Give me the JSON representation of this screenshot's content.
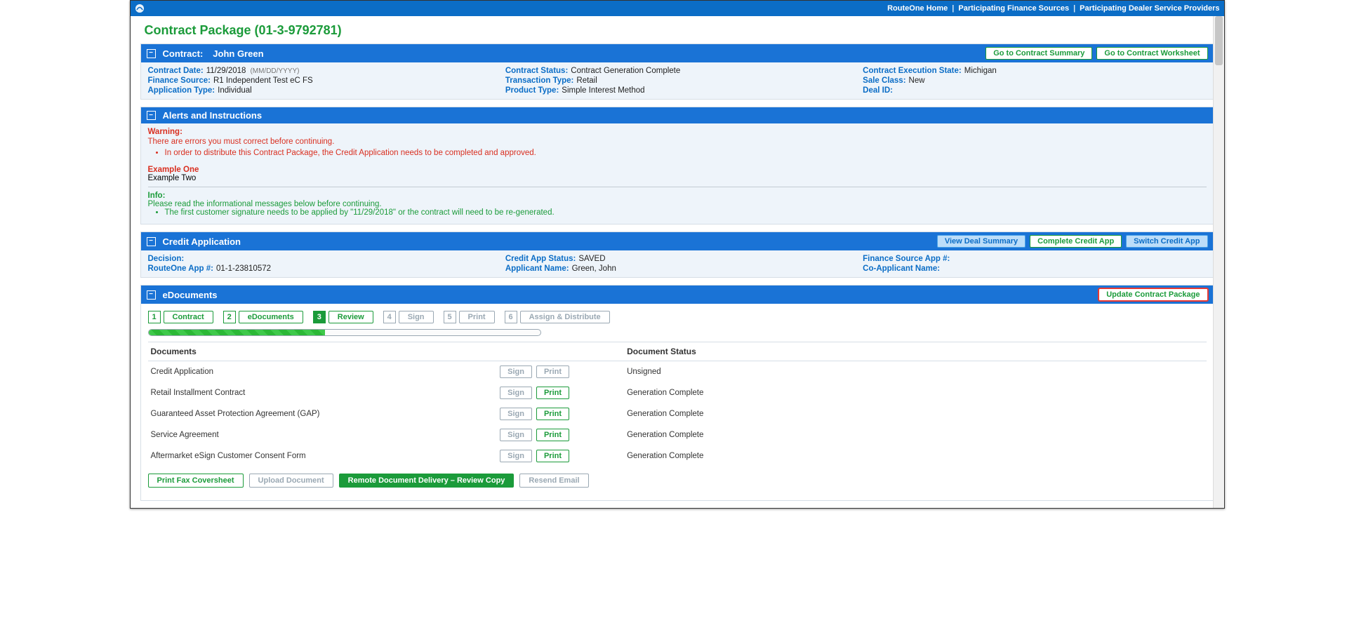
{
  "topbar": {
    "links": [
      "RouteOne Home",
      "Participating Finance Sources",
      "Participating Dealer Service Providers"
    ]
  },
  "page_title": "Contract Package (01-3-9792781)",
  "contract_header": {
    "label": "Contract:",
    "name": "John Green",
    "buttons": {
      "summary": "Go to Contract Summary",
      "worksheet": "Go to Contract Worksheet"
    }
  },
  "contract_info": {
    "contract_date_label": "Contract Date:",
    "contract_date": "11/29/2018",
    "contract_date_hint": "(MM/DD/YYYY)",
    "contract_status_label": "Contract Status:",
    "contract_status": "Contract Generation Complete",
    "exec_state_label": "Contract Execution State:",
    "exec_state": "Michigan",
    "fin_source_label": "Finance Source:",
    "fin_source": "R1 Independent Test eC FS",
    "trans_type_label": "Transaction Type:",
    "trans_type": "Retail",
    "sale_class_label": "Sale Class:",
    "sale_class": "New",
    "app_type_label": "Application Type:",
    "app_type": "Individual",
    "prod_type_label": "Product Type:",
    "prod_type": "Simple Interest Method",
    "deal_id_label": "Deal ID:",
    "deal_id": ""
  },
  "alerts": {
    "title": "Alerts and Instructions",
    "warning_title": "Warning:",
    "warning_text": "There are errors you must correct before continuing.",
    "warning_bullet": "In order to distribute this Contract Package, the Credit Application needs to be completed and approved.",
    "example1": "Example One",
    "example2": "Example Two",
    "info_title": "Info:",
    "info_text": "Please read the informational messages below before continuing.",
    "info_bullet": "The first customer signature needs to be applied by \"11/29/2018\" or the contract will need to be re-generated."
  },
  "credit_app": {
    "title": "Credit Application",
    "buttons": {
      "view": "View Deal Summary",
      "complete": "Complete Credit App",
      "switch": "Switch Credit App"
    },
    "decision_label": "Decision:",
    "decision": "",
    "status_label": "Credit App Status:",
    "status": "SAVED",
    "fs_app_label": "Finance Source App #:",
    "fs_app": "",
    "r1_app_label": "RouteOne App #:",
    "r1_app": "01-1-23810572",
    "app_name_label": "Applicant Name:",
    "app_name": "Green, John",
    "coapp_label": "Co-Applicant Name:",
    "coapp": ""
  },
  "edocs": {
    "title": "eDocuments",
    "update_btn": "Update Contract Package",
    "steps": [
      {
        "n": "1",
        "label": "Contract",
        "state": "on"
      },
      {
        "n": "2",
        "label": "eDocuments",
        "state": "on"
      },
      {
        "n": "3",
        "label": "Review",
        "state": "active"
      },
      {
        "n": "4",
        "label": "Sign",
        "state": "off"
      },
      {
        "n": "5",
        "label": "Print",
        "state": "off"
      },
      {
        "n": "6",
        "label": "Assign & Distribute",
        "state": "off"
      }
    ],
    "progress_pct": 45,
    "cols": {
      "docs": "Documents",
      "status": "Document Status"
    },
    "rows": [
      {
        "name": "Credit Application",
        "sign": "muted",
        "print": "muted",
        "status": "Unsigned"
      },
      {
        "name": "Retail Installment Contract",
        "sign": "muted",
        "print": "on",
        "status": "Generation Complete"
      },
      {
        "name": "Guaranteed Asset Protection Agreement (GAP)",
        "sign": "muted",
        "print": "on",
        "status": "Generation Complete"
      },
      {
        "name": "Service Agreement",
        "sign": "muted",
        "print": "on",
        "status": "Generation Complete"
      },
      {
        "name": "Aftermarket eSign Customer Consent Form",
        "sign": "muted",
        "print": "on",
        "status": "Generation Complete"
      }
    ],
    "btn_labels": {
      "sign": "Sign",
      "print": "Print"
    },
    "bottom": {
      "fax": "Print Fax Coversheet",
      "upload": "Upload Document",
      "remote": "Remote Document Delivery – Review Copy",
      "resend": "Resend Email"
    }
  }
}
